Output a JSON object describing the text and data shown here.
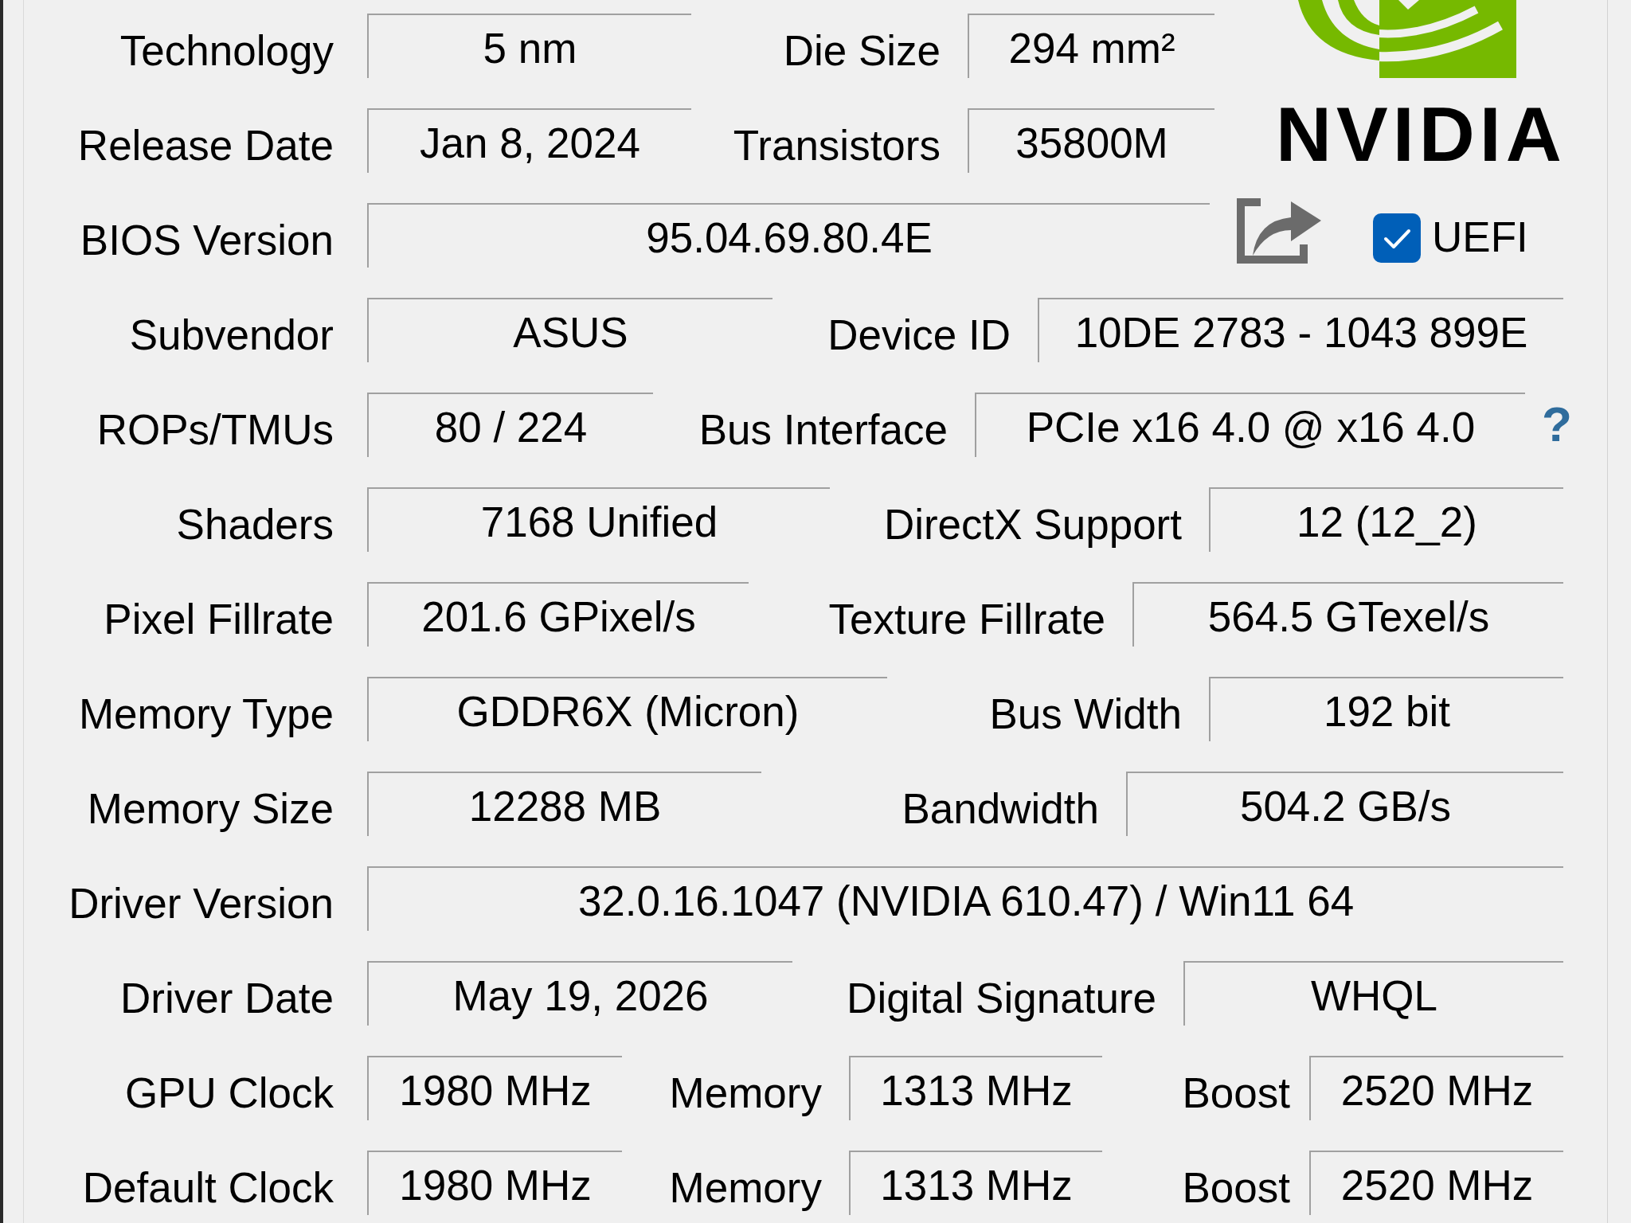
{
  "logo": {
    "wordmark": "NVIDIA"
  },
  "rows": [
    {
      "fields": [
        {
          "label": "Technology",
          "value": "5 nm"
        },
        {
          "label": "Die Size",
          "value": "294 mm²"
        }
      ]
    },
    {
      "fields": [
        {
          "label": "Release Date",
          "value": "Jan 8, 2024"
        },
        {
          "label": "Transistors",
          "value": "35800M"
        }
      ]
    },
    {
      "fields": [
        {
          "label": "BIOS Version",
          "value": "95.04.69.80.4E"
        }
      ],
      "checkbox": {
        "label": "UEFI",
        "checked": true
      }
    },
    {
      "fields": [
        {
          "label": "Subvendor",
          "value": "ASUS"
        },
        {
          "label": "Device ID",
          "value": "10DE 2783 - 1043 899E"
        }
      ]
    },
    {
      "fields": [
        {
          "label": "ROPs/TMUs",
          "value": "80 / 224"
        },
        {
          "label": "Bus Interface",
          "value": "PCIe x16 4.0 @ x16 4.0"
        }
      ],
      "help_button": "?"
    },
    {
      "fields": [
        {
          "label": "Shaders",
          "value": "7168 Unified"
        },
        {
          "label": "DirectX Support",
          "value": "12 (12_2)"
        }
      ]
    },
    {
      "fields": [
        {
          "label": "Pixel Fillrate",
          "value": "201.6 GPixel/s"
        },
        {
          "label": "Texture Fillrate",
          "value": "564.5 GTexel/s"
        }
      ]
    },
    {
      "fields": [
        {
          "label": "Memory Type",
          "value": "GDDR6X (Micron)"
        },
        {
          "label": "Bus Width",
          "value": "192 bit"
        }
      ]
    },
    {
      "fields": [
        {
          "label": "Memory Size",
          "value": "12288 MB"
        },
        {
          "label": "Bandwidth",
          "value": "504.2 GB/s"
        }
      ]
    },
    {
      "fields": [
        {
          "label": "Driver Version",
          "value": "32.0.16.1047 (NVIDIA 610.47) / Win11 64"
        }
      ]
    },
    {
      "fields": [
        {
          "label": "Driver Date",
          "value": "May 19, 2026"
        },
        {
          "label": "Digital Signature",
          "value": "WHQL"
        }
      ]
    },
    {
      "fields": [
        {
          "label": "GPU Clock",
          "value": "1980 MHz"
        },
        {
          "label": "Memory",
          "value": "1313 MHz"
        },
        {
          "label": "Boost",
          "value": "2520 MHz"
        }
      ]
    },
    {
      "fields": [
        {
          "label": "Default Clock",
          "value": "1980 MHz"
        },
        {
          "label": "Memory",
          "value": "1313 MHz"
        },
        {
          "label": "Boost",
          "value": "2520 MHz"
        }
      ]
    }
  ]
}
